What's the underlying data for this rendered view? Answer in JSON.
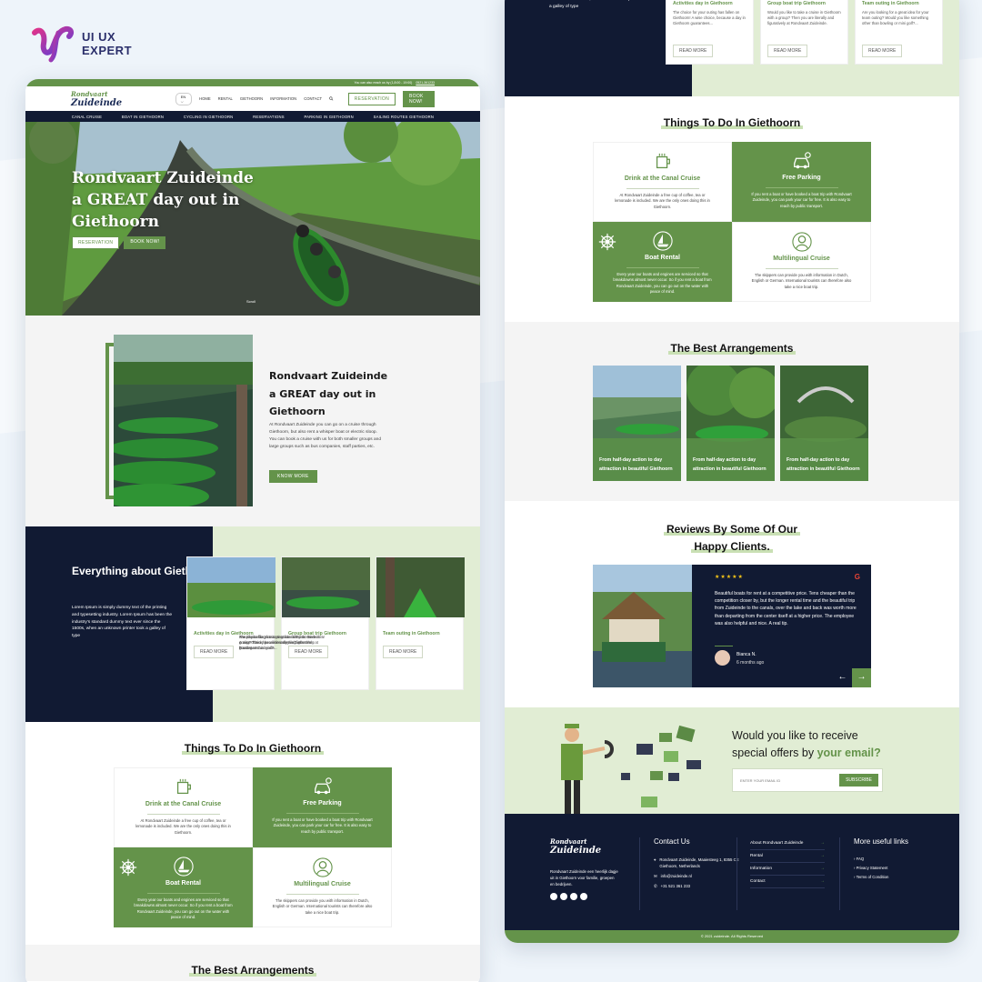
{
  "brand": {
    "line1": "UI UX",
    "line2": "EXPERT"
  },
  "colors": {
    "green": "#64934a",
    "navy": "#111a33",
    "light_green": "#e1edd4"
  },
  "topbar": {
    "text": "You can also reach us by (1,8:00 - 19:00)",
    "phone": "0521-361233"
  },
  "nav": {
    "logo_left": "Rondvaart",
    "logo_right": "Zuideinde",
    "lang": "EN",
    "links": [
      "HOME",
      "RENTAL",
      "GIETHOORN",
      "INFORMATION",
      "CONTACT"
    ],
    "reservation": "RESERVATION",
    "book": "BOOK NOW!"
  },
  "subnav": [
    "CANAL CRUISE",
    "BOAT IN GIETHOORN",
    "CYCLING IN GIETHOORN",
    "RESERVATIONS",
    "PARKING IN GIETHOORN",
    "SAILING ROUTES GIETHOORN"
  ],
  "hero": {
    "title": "Rondvaart Zuideinde a GREAT day out in Giethoorn",
    "reservation": "RESERVATION",
    "book": "BOOK NOW!",
    "scroll": "Scroll"
  },
  "intro": {
    "title": "Rondvaart Zuideinde a GREAT day out in Giethoorn",
    "text": "At Rondvaart Zuideinde you can go on a cruise through Giethoorn, but also rent a whisper boat or electric sloop. You can book a cruise with us for both smaller groups and large groups such as bus companies, staff parties, etc.",
    "button": "KNOW MORE"
  },
  "about": {
    "title": "Everything about Giethoorn",
    "text": "Lorem Ipsum is simply dummy text of the printing and typesetting industry. Lorem Ipsum has been the industry's standard dummy text ever since the 1500s, when an unknown printer took a galley of type",
    "cards": [
      {
        "title": "Activities day in Giethoorn",
        "text": "The choice for your outing has fallen on Giethoorn! A wise choice, because a day in Giethoorn guarantees...",
        "button": "READ MORE"
      },
      {
        "title": "Group boat trip Giethoorn",
        "text": "Would you like to take a cruise in Giethoorn with a group? Then you are literally and figuratively at Rondvaart Zuideinde.",
        "button": "READ MORE"
      },
      {
        "title": "Team outing in Giethoorn",
        "text": "Are you looking for a great idea for your team outing? Would you like something other than bowling or mini golf?...",
        "button": "READ MORE"
      }
    ]
  },
  "about_partial": {
    "text": "Ipsum has been the industry's standard dummy text ever since the 1500s, when an unknown printer took a galley of type"
  },
  "things": {
    "title": "Things To Do In Giethoorn",
    "items": [
      {
        "title": "Drink at the Canal Cruise",
        "text": "At Rondvaart Zuideinde a free cup of coffee, tea or lemonade is included. We are the only ones doing this in Giethoorn.",
        "icon": "cup-icon"
      },
      {
        "title": "Free Parking",
        "text": "If you rent a boat or have booked a boat trip with Rondvaart Zuideinde, you can park your car for free. It is also easy to reach by public transport.",
        "icon": "car-icon"
      },
      {
        "title": "Boat Rental",
        "text": "Every year our boats and engines are serviced so that breakdowns almost never occur. So if you rent a boat from Rondvaart Zuideinde, you can go out on the water with peace of mind.",
        "icon": "boat-icon"
      },
      {
        "title": "Multilingual Cruise",
        "text": "The skippers can provide you with information in Dutch, English or German. International tourists can therefore also take a nice boat trip.",
        "icon": "guide-icon"
      }
    ]
  },
  "arrangements": {
    "title": "The Best Arrangements",
    "items": [
      {
        "text": "From half-day action to day attraction in beautiful Giethoorn"
      },
      {
        "text": "From half-day action to day attraction in beautiful Giethoorn"
      },
      {
        "text": "From half-day action to day attraction in beautiful Giethoorn"
      }
    ]
  },
  "reviews": {
    "title_line1": "Reviews By Some Of Our",
    "title_line2": "Happy Clients.",
    "stars": "★★★★★",
    "text": "Beautiful boats for rent at a competitive price. Tens cheaper than the competition closer by, but the longer rental time and the beautiful trip from Zuideinde to the canals, over the lake and back was worth more than departing from the center itself at a higher price. The employee was also helpful and nice. A real tip.",
    "name": "Bianca N.",
    "ago": "6 months ago",
    "prev": "←",
    "next": "→",
    "google": "G"
  },
  "newsletter": {
    "line1": "Would you like to receive",
    "line2_a": "special offers by ",
    "line2_b": "your email?",
    "placeholder": "ENTER YOUR EMAIL ID",
    "button": "SUBSCRIBE"
  },
  "footer": {
    "logo_left": "Rondvaart",
    "logo_right": "Zuideinde",
    "about": "Rondvaart Zuideinde een heerlijk dagje uit in Giethoorn voor familie, groepen en bedrijven.",
    "contact_title": "Contact Us",
    "address": "Rondvaart Zuideinde, Maaiesteeg 1, 8355 CE Giethoorn, Netherlands",
    "email": "info@zuideinde.nl",
    "phone": "+31 521 361 233",
    "links": [
      "About Rondvaart Zuideinde",
      "Rental",
      "Information",
      "Contact"
    ],
    "more_title": "More useful links",
    "more": [
      "FAQ",
      "Privacy Statement",
      "Terms of Condition"
    ],
    "copyright": "© 2021 zuideinde. All Rights Reserved"
  }
}
